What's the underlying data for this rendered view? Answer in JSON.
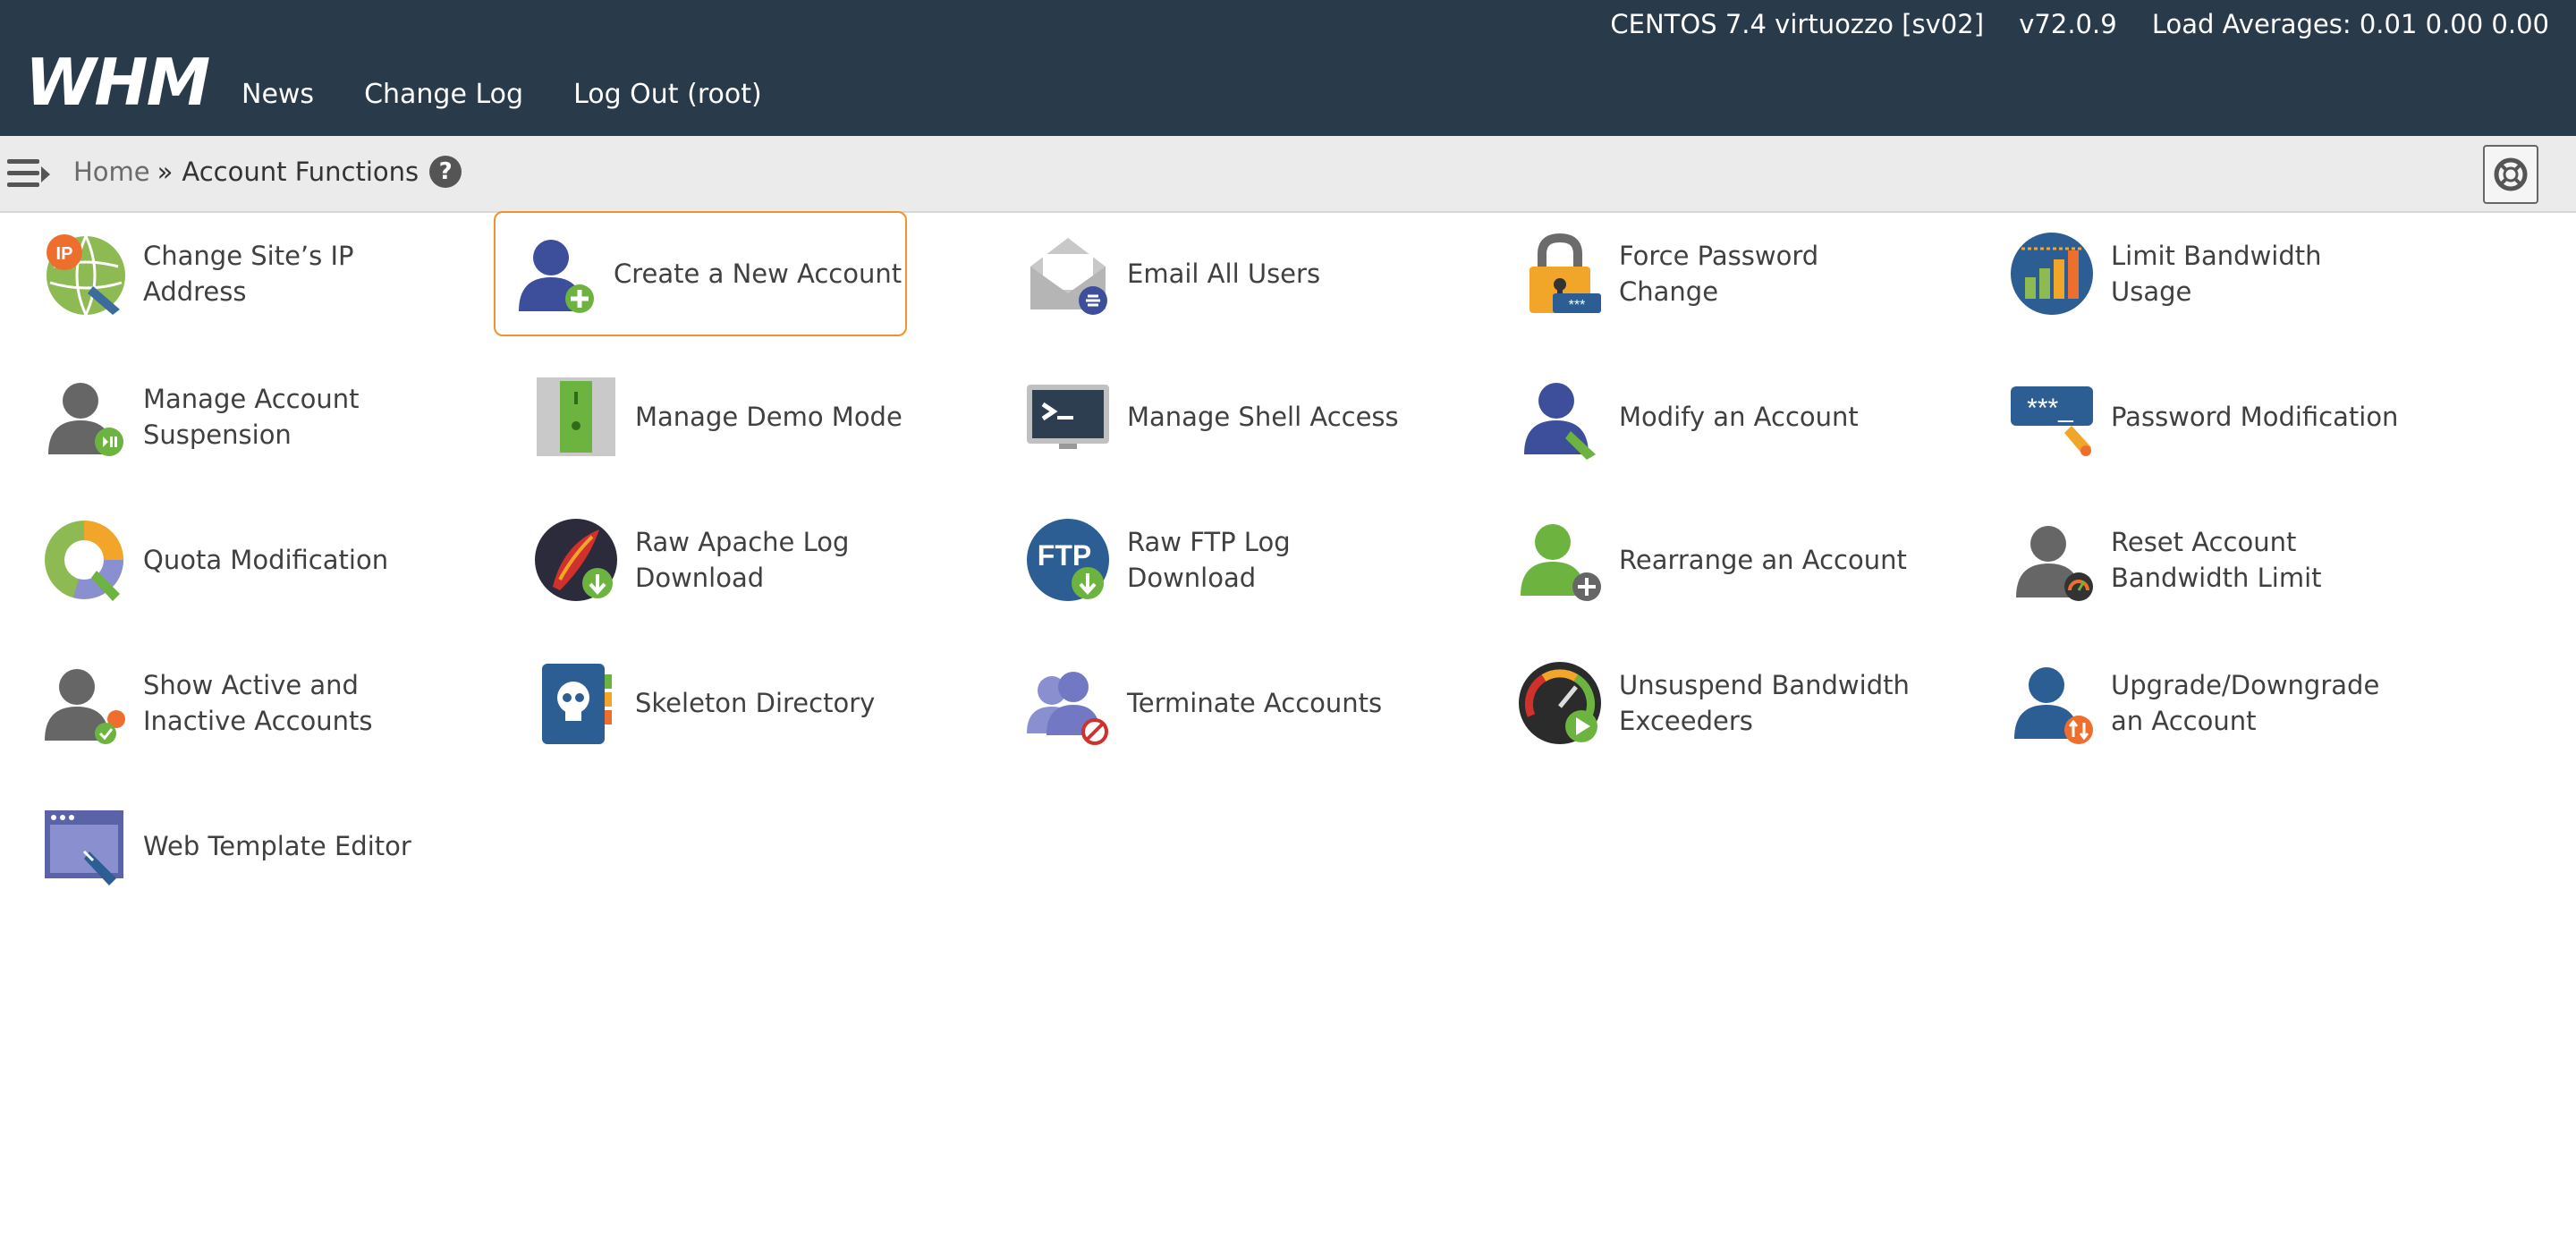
{
  "header": {
    "os": "CENTOS 7.4 virtuozzo [sv02]",
    "version": "v72.0.9",
    "load": "Load Averages: 0.01 0.00 0.00",
    "logo": "WHM",
    "nav": [
      "News",
      "Change Log",
      "Log Out (root)"
    ]
  },
  "breadcrumb": {
    "home": "Home",
    "separator": "»",
    "current": "Account Functions",
    "help": "?"
  },
  "tiles": [
    {
      "label": "Change Site’s IP Address",
      "icon": "globe-ip-icon"
    },
    {
      "label": "Create a New Account",
      "icon": "user-add-icon"
    },
    {
      "label": "Email All Users",
      "icon": "envelope-icon"
    },
    {
      "label": "Force Password Change",
      "icon": "padlock-icon"
    },
    {
      "label": "Limit Bandwidth Usage",
      "icon": "bandwidth-chart-icon"
    },
    {
      "label": "Manage Account Suspension",
      "icon": "user-pause-icon"
    },
    {
      "label": "Manage Demo Mode",
      "icon": "demo-door-icon"
    },
    {
      "label": "Manage Shell Access",
      "icon": "terminal-icon"
    },
    {
      "label": "Modify an Account",
      "icon": "user-edit-icon"
    },
    {
      "label": "Password Modification",
      "icon": "password-field-icon"
    },
    {
      "label": "Quota Modification",
      "icon": "pie-chart-icon"
    },
    {
      "label": "Raw Apache Log Download",
      "icon": "apache-feather-icon"
    },
    {
      "label": "Raw FTP Log Download",
      "icon": "ftp-download-icon"
    },
    {
      "label": "Rearrange an Account",
      "icon": "user-move-icon"
    },
    {
      "label": "Reset Account Bandwidth Limit",
      "icon": "user-gauge-icon"
    },
    {
      "label": "Show Active and Inactive Accounts",
      "icon": "user-status-icon"
    },
    {
      "label": "Skeleton Directory",
      "icon": "skull-book-icon"
    },
    {
      "label": "Terminate Accounts",
      "icon": "users-remove-icon"
    },
    {
      "label": "Unsuspend Bandwidth Exceeders",
      "icon": "gauge-play-icon"
    },
    {
      "label": "Upgrade/Downgrade an Account",
      "icon": "user-updown-icon"
    },
    {
      "label": "Web Template Editor",
      "icon": "browser-edit-icon"
    }
  ],
  "selected_index": 1
}
